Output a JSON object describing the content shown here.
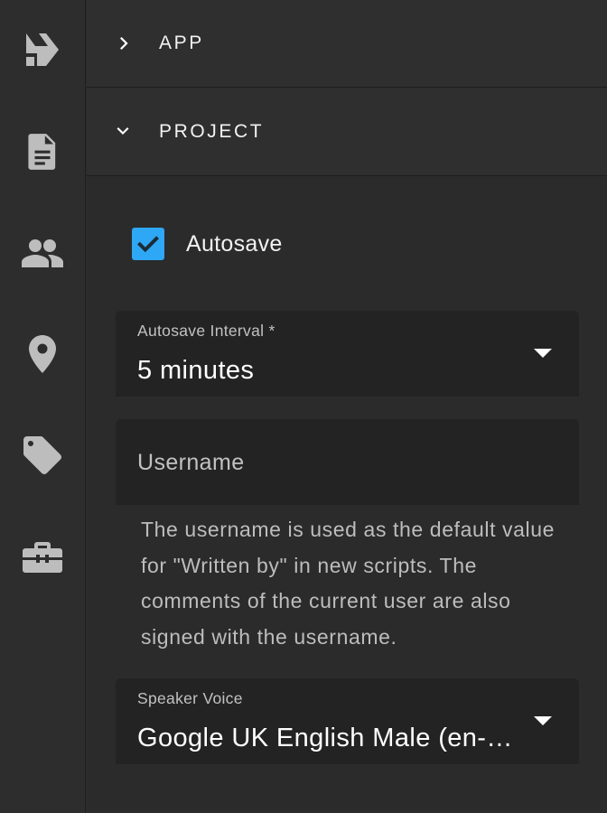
{
  "sidebar": {
    "items": [
      {
        "icon": "logo-icon"
      },
      {
        "icon": "document-icon"
      },
      {
        "icon": "people-icon"
      },
      {
        "icon": "location-pin-icon"
      },
      {
        "icon": "tag-icon"
      },
      {
        "icon": "toolbox-icon"
      }
    ]
  },
  "panels": {
    "app": {
      "title": "APP",
      "expanded": false
    },
    "project": {
      "title": "PROJECT",
      "expanded": true
    }
  },
  "autosave": {
    "label": "Autosave",
    "checked": true,
    "color": "#2ea7f5"
  },
  "autosave_interval": {
    "label": "Autosave Interval *",
    "value": "5 minutes"
  },
  "username": {
    "placeholder": "Username",
    "value": "",
    "hint": "The username is used as the default value for \"Written by\" in new scripts. The comments of the current user are also signed with the username."
  },
  "speaker_voice": {
    "label": "Speaker Voice",
    "value": "Google UK English Male (en-GB)"
  }
}
